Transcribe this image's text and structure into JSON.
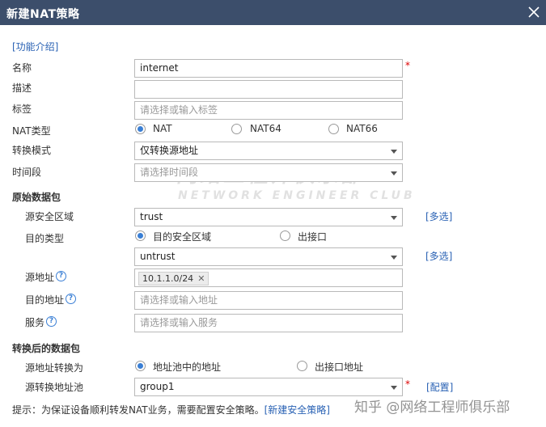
{
  "dialog": {
    "title": "新建NAT策略"
  },
  "intro_link": "[功能介绍]",
  "form": {
    "name": {
      "label": "名称",
      "value": "internet"
    },
    "description": {
      "label": "描述",
      "value": ""
    },
    "tag": {
      "label": "标签",
      "placeholder": "请选择或输入标签"
    },
    "nat_type": {
      "label": "NAT类型",
      "options": [
        "NAT",
        "NAT64",
        "NAT66"
      ],
      "selected": "NAT"
    },
    "convert_mode": {
      "label": "转换模式",
      "value": "仅转换源地址"
    },
    "time_range": {
      "label": "时间段",
      "placeholder": "请选择时间段"
    }
  },
  "original_packet": {
    "title": "原始数据包",
    "src_zone": {
      "label": "源安全区域",
      "value": "trust",
      "multi_link": "[多选]"
    },
    "dst_type": {
      "label": "目的类型",
      "options": [
        "目的安全区域",
        "出接口"
      ],
      "selected": "目的安全区域"
    },
    "dst_zone": {
      "value": "untrust",
      "multi_link": "[多选]"
    },
    "src_addr": {
      "label": "源地址",
      "tag": "10.1.1.0/24",
      "tag_close": "✕"
    },
    "dst_addr": {
      "label": "目的地址",
      "placeholder": "请选择或输入地址"
    },
    "service": {
      "label": "服务",
      "placeholder": "请选择或输入服务"
    }
  },
  "translated_packet": {
    "title": "转换后的数据包",
    "src_translate": {
      "label": "源地址转换为",
      "options": [
        "地址池中的地址",
        "出接口地址"
      ],
      "selected": "地址池中的地址"
    },
    "src_pool": {
      "label": "源转换地址池",
      "value": "group1",
      "config_link": "[配置]"
    }
  },
  "footer": {
    "tip": "提示：为保证设备顺利转发NAT业务，需要配置安全策略。",
    "new_policy_link": "[新建安全策略]"
  },
  "watermarks": {
    "cn": "网络工程师俱乐部",
    "en": "NETWORK ENGINEER CLUB",
    "zhihu": "知乎 @网络工程师俱乐部"
  },
  "help_glyph": "?",
  "required_mark": "*"
}
